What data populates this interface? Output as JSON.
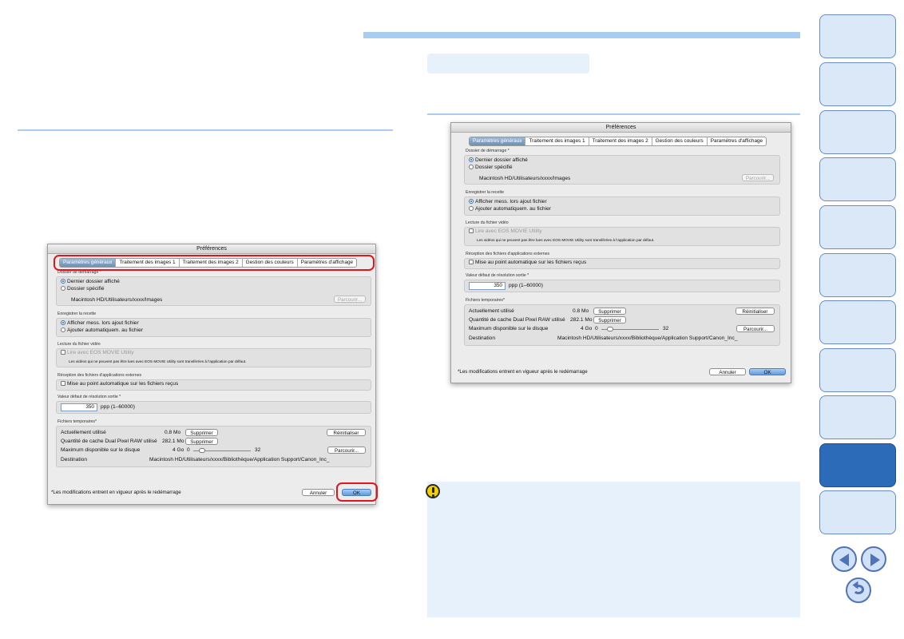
{
  "dialog": {
    "title": "Préférences",
    "tabs": [
      "Paramètres généraux",
      "Traitement des images 1",
      "Traitement des images 2",
      "Gestion des couleurs",
      "Paramètres d'affichage"
    ],
    "startup": {
      "label": "Dossier de démarrage *",
      "option_last": "Dernier dossier affiché",
      "option_specified": "Dossier spécifié",
      "path": "Macintosh HD/Utilisateurs/xxxx/Images",
      "browse": "Parcourir..."
    },
    "recipe": {
      "label": "Enregistrer la recette",
      "option_show": "Afficher mess. lors ajout fichier",
      "option_auto": "Ajouter automatiquem. au fichier"
    },
    "video": {
      "label": "Lecture du fichier vidéo",
      "option": "Lire avec EOS MOVIE Utility",
      "note": "Les vidéos qui ne peuvent pas être lues avec EOS MOVIE Utility sont transférées à l'application par défaut."
    },
    "external": {
      "label": "Réception des fichiers d'applications externes",
      "option": "Mise au point automatique sur les fichiers reçus"
    },
    "resolution": {
      "label": "Valeur défaut de résolution sortie *",
      "value": "350",
      "unit": "ppp (1–60000)"
    },
    "temp": {
      "label": "Fichiers temporaires*",
      "current_label": "Actuellement utilisé",
      "current_value": "0.8 Mo",
      "cache_label": "Quantité de cache Dual Pixel RAW utilisé",
      "cache_value": "282.1 Mo",
      "max_label": "Maximum disponible sur le disque",
      "max_value": "4 Go",
      "slider_min": "0",
      "slider_max": "32",
      "dest_label": "Destination",
      "dest_value": "Macintosh HD/Utilisateurs/xxxx/Bibliothèque/Application Support/Canon_Inc_",
      "delete": "Supprimer",
      "reset": "Réinitialiser",
      "browse": "Parcourir..."
    },
    "footnote": "*Les modifications entrent en vigueur après le redémarrage",
    "cancel": "Annuler",
    "ok": "OK"
  },
  "colors": {
    "accent": "#a8cdf0",
    "highlight": "#e0161e",
    "nav_active": "#2b6bb8"
  },
  "icons": [
    "caution-icon",
    "previous-page-icon",
    "next-page-icon",
    "return-icon"
  ]
}
